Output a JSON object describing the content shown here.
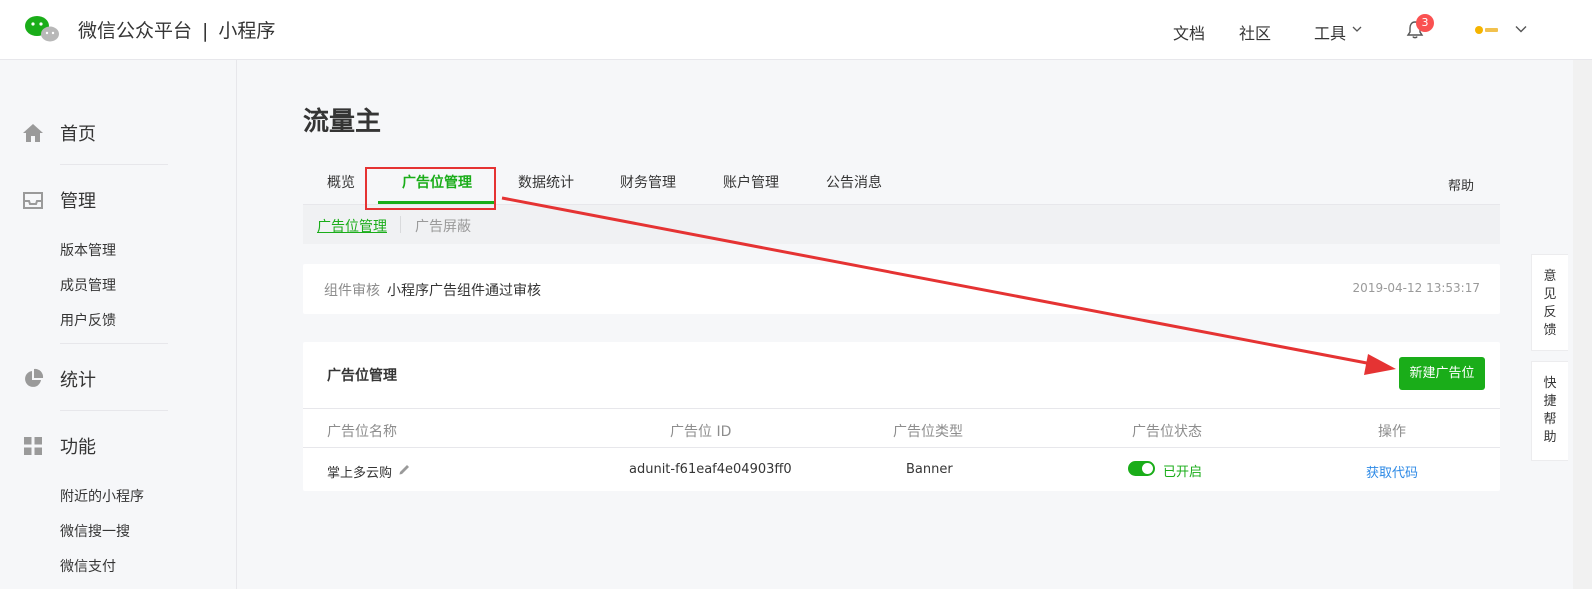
{
  "header": {
    "brand_name": "微信公众平台",
    "brand_separator": "|",
    "brand_product": "小程序",
    "nav": [
      "文档",
      "社区",
      "工具"
    ],
    "notification_count": "3",
    "colors": {
      "accent": "#1aad19",
      "badge": "#fa5151"
    }
  },
  "sidebar": {
    "sections": [
      {
        "label": "首页",
        "icon": "home-icon",
        "items": []
      },
      {
        "label": "管理",
        "icon": "inbox-icon",
        "items": [
          "版本管理",
          "成员管理",
          "用户反馈"
        ]
      },
      {
        "label": "统计",
        "icon": "pie-chart-icon",
        "items": []
      },
      {
        "label": "功能",
        "icon": "grid-icon",
        "items": [
          "附近的小程序",
          "微信搜一搜",
          "微信支付"
        ]
      }
    ]
  },
  "page": {
    "title": "流量主",
    "tabs": [
      "概览",
      "广告位管理",
      "数据统计",
      "财务管理",
      "账户管理",
      "公告消息"
    ],
    "active_tab": "广告位管理",
    "help": "帮助",
    "subtabs": [
      "广告位管理",
      "广告屏蔽"
    ],
    "notice": {
      "label": "组件审核",
      "message": "小程序广告组件通过审核",
      "time": "2019-04-12 13:53:17"
    },
    "panel": {
      "title": "广告位管理",
      "new_button": "新建广告位",
      "columns": [
        "广告位名称",
        "广告位 ID",
        "广告位类型",
        "广告位状态",
        "操作"
      ],
      "rows": [
        {
          "name": "掌上多云购",
          "id": "adunit-f61eaf4e04903ff0",
          "type": "Banner",
          "status": "已开启",
          "status_on": true,
          "action": "获取代码"
        }
      ]
    }
  },
  "floating": {
    "feedback": [
      "意",
      "见",
      "反",
      "馈"
    ],
    "quick_help": [
      "快",
      "捷",
      "帮",
      "助"
    ]
  }
}
